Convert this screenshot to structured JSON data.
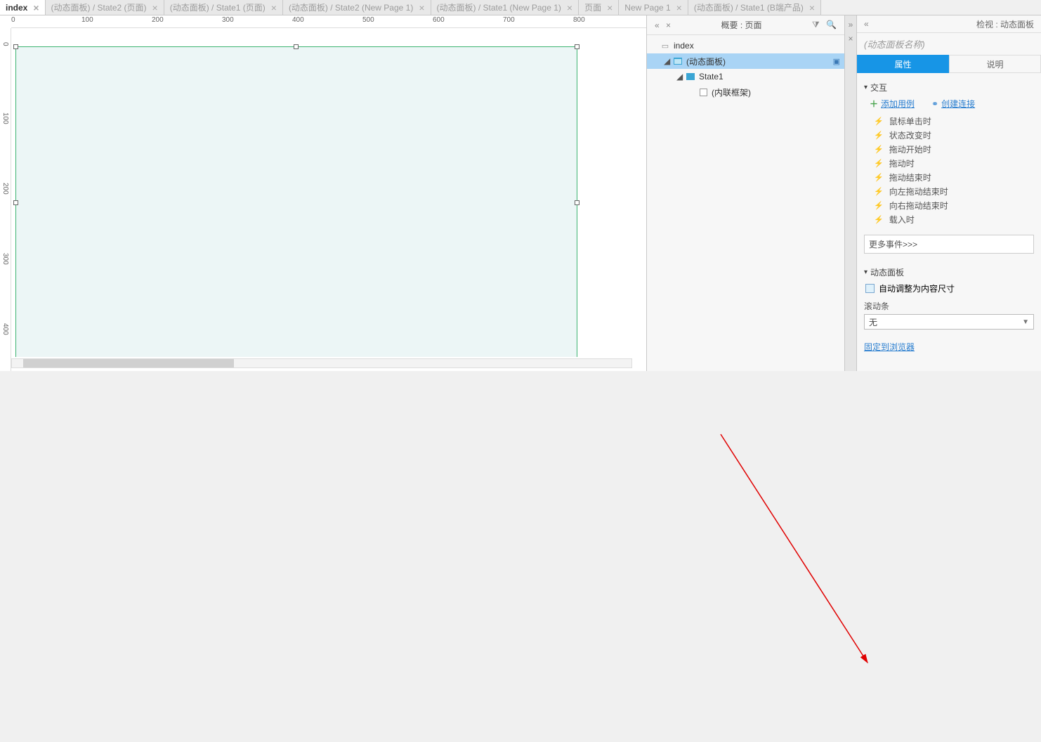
{
  "tabs": [
    {
      "label": "index",
      "active": true
    },
    {
      "label": "(动态面板) / State2 (页面)",
      "active": false
    },
    {
      "label": "(动态面板) / State1 (页面)",
      "active": false
    },
    {
      "label": "(动态面板) / State2 (New Page 1)",
      "active": false
    },
    {
      "label": "(动态面板) / State1 (New Page 1)",
      "active": false
    },
    {
      "label": "页面",
      "active": false
    },
    {
      "label": "New Page 1",
      "active": false
    },
    {
      "label": "(动态面板) / State1 (B端产品)",
      "active": false
    }
  ],
  "ruler_h": [
    "0",
    "100",
    "200",
    "300",
    "400",
    "500",
    "600",
    "700",
    "800"
  ],
  "ruler_v": [
    "0",
    "100",
    "200",
    "300",
    "400"
  ],
  "outline": {
    "title": "概要 : 页面",
    "items": [
      {
        "indent": 0,
        "icon": "page",
        "label": "index",
        "caret": false
      },
      {
        "indent": 1,
        "icon": "panel",
        "label": "(动态面板)",
        "caret": true,
        "selected": true,
        "edit": true
      },
      {
        "indent": 2,
        "icon": "state",
        "label": "State1",
        "caret": true
      },
      {
        "indent": 3,
        "icon": "box",
        "label": "(内联框架)",
        "caret": false
      }
    ]
  },
  "props": {
    "top_label": "检视 : 动态面板",
    "name_placeholder": "(动态面板名称)",
    "tab_on": "属性",
    "tab_off": "说明",
    "section_interact": "交互",
    "add_case": "添加用例",
    "create_link": "创建连接",
    "events": [
      "鼠标单击时",
      "状态改变时",
      "拖动开始时",
      "拖动时",
      "拖动结束时",
      "向左拖动结束时",
      "向右拖动结束时",
      "载入时"
    ],
    "more": "更多事件>>>",
    "section_panel": "动态面板",
    "auto_fit": "自动调整为内容尺寸",
    "scrollbar_label": "滚动条",
    "scrollbar_value": "无",
    "fix_link": "固定到浏览器"
  }
}
